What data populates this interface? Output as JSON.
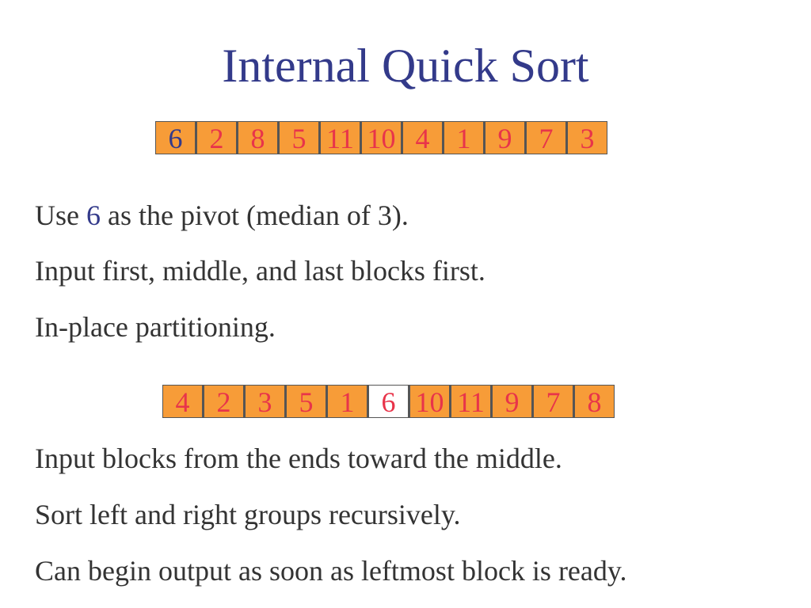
{
  "title": "Internal Quick Sort",
  "array_initial": [
    "6",
    "2",
    "8",
    "5",
    "11",
    "10",
    "4",
    "1",
    "9",
    "7",
    "3"
  ],
  "array_partitioned": [
    "4",
    "2",
    "3",
    "5",
    "1",
    "6",
    "10",
    "11",
    "9",
    "7",
    "8"
  ],
  "colors": {
    "cell_fill": "#f79c38",
    "cell_text": "#e8344a",
    "pivot_text": "#333a8a",
    "title": "#333a8a"
  },
  "lines": {
    "pivot_pre": "Use ",
    "pivot_value": "6",
    "pivot_post": " as the pivot (median of 3).",
    "l2": "Input first, middle, and last blocks first.",
    "l3": "In-place partitioning.",
    "l4": "Input blocks from the ends toward the middle.",
    "l5": "Sort left and right groups recursively.",
    "l6": "Can begin output as soon as leftmost block is ready."
  }
}
